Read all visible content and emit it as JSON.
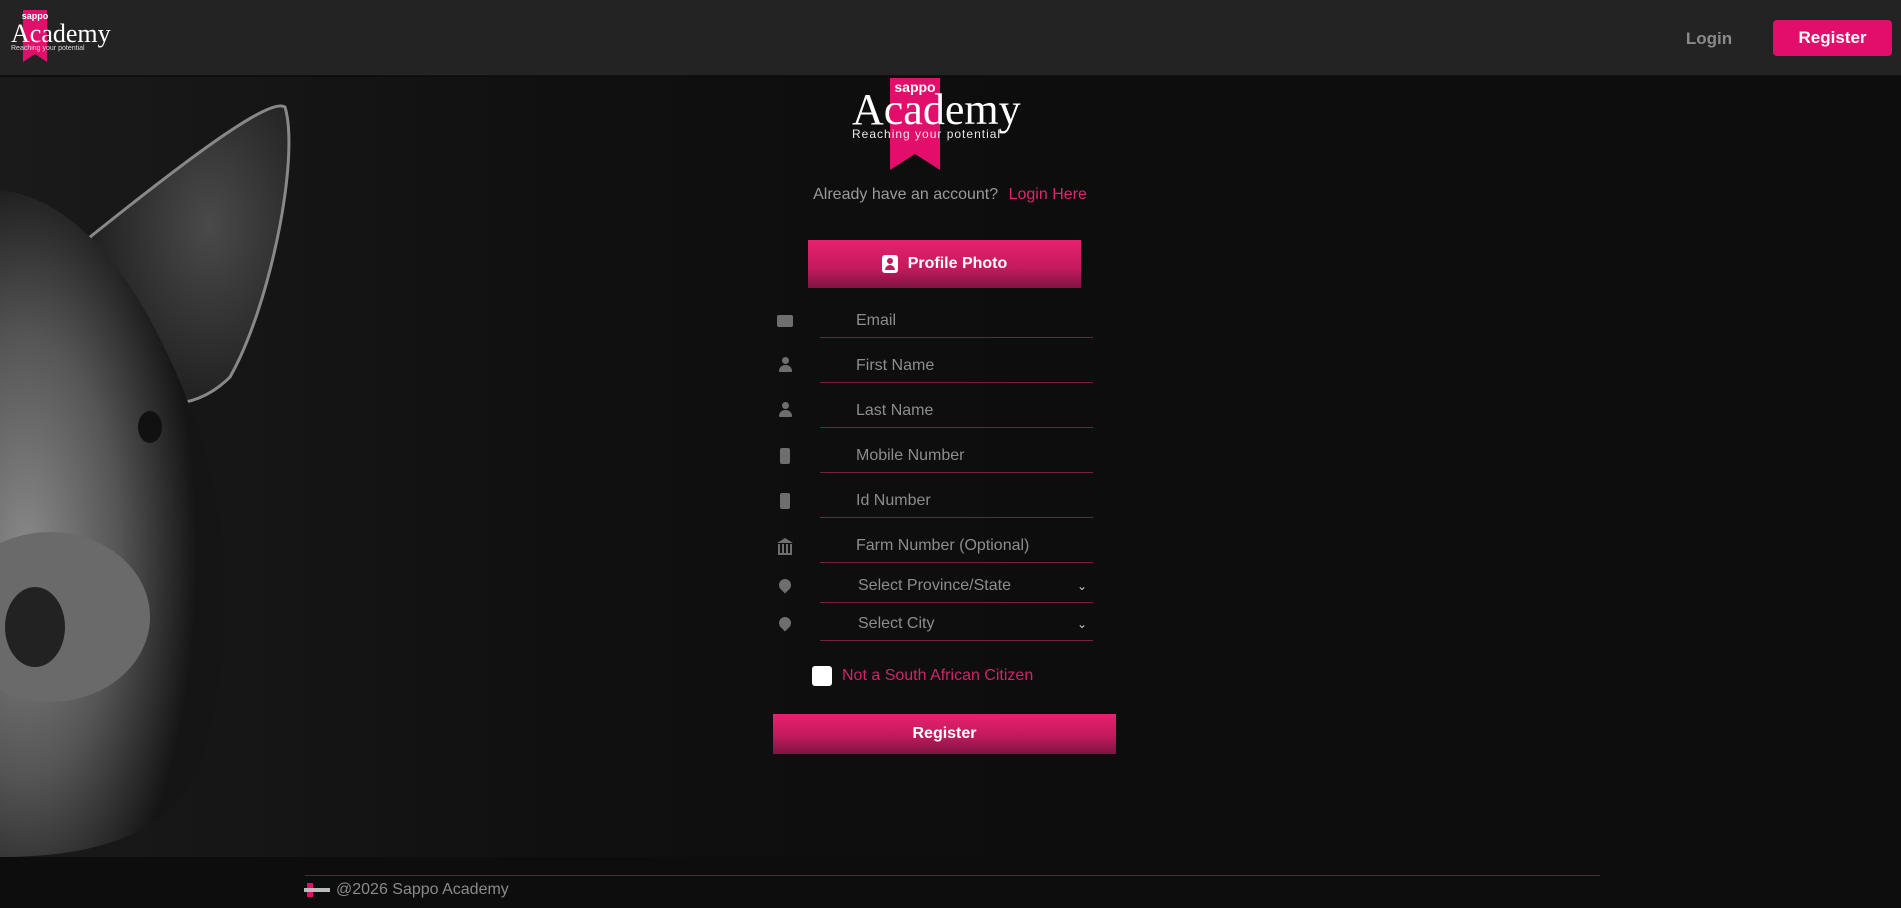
{
  "brand": {
    "badge": "sappo",
    "name": "Academy",
    "tagline": "Reaching your potential",
    "accent_color": "#e30e6c"
  },
  "nav": {
    "login_label": "Login",
    "register_label": "Register"
  },
  "form": {
    "already_text": "Already have an account?",
    "login_link": "Login Here",
    "profile_photo_label": "Profile Photo",
    "fields": [
      {
        "icon": "envelope-icon",
        "placeholder": "Email"
      },
      {
        "icon": "user-icon",
        "placeholder": "First Name"
      },
      {
        "icon": "user-icon",
        "placeholder": "Last Name"
      },
      {
        "icon": "mobile-icon",
        "placeholder": "Mobile Number"
      },
      {
        "icon": "mobile-icon",
        "placeholder": "Id Number"
      },
      {
        "icon": "bank-icon",
        "placeholder": "Farm Number (Optional)"
      }
    ],
    "selects": [
      {
        "icon": "location-pin-icon",
        "value": "Select Province/State"
      },
      {
        "icon": "location-pin-icon",
        "value": "Select City"
      }
    ],
    "citizen_label": "Not a South African Citizen",
    "submit_label": "Register"
  },
  "footer": {
    "copyright": "@2026 Sappo Academy"
  }
}
